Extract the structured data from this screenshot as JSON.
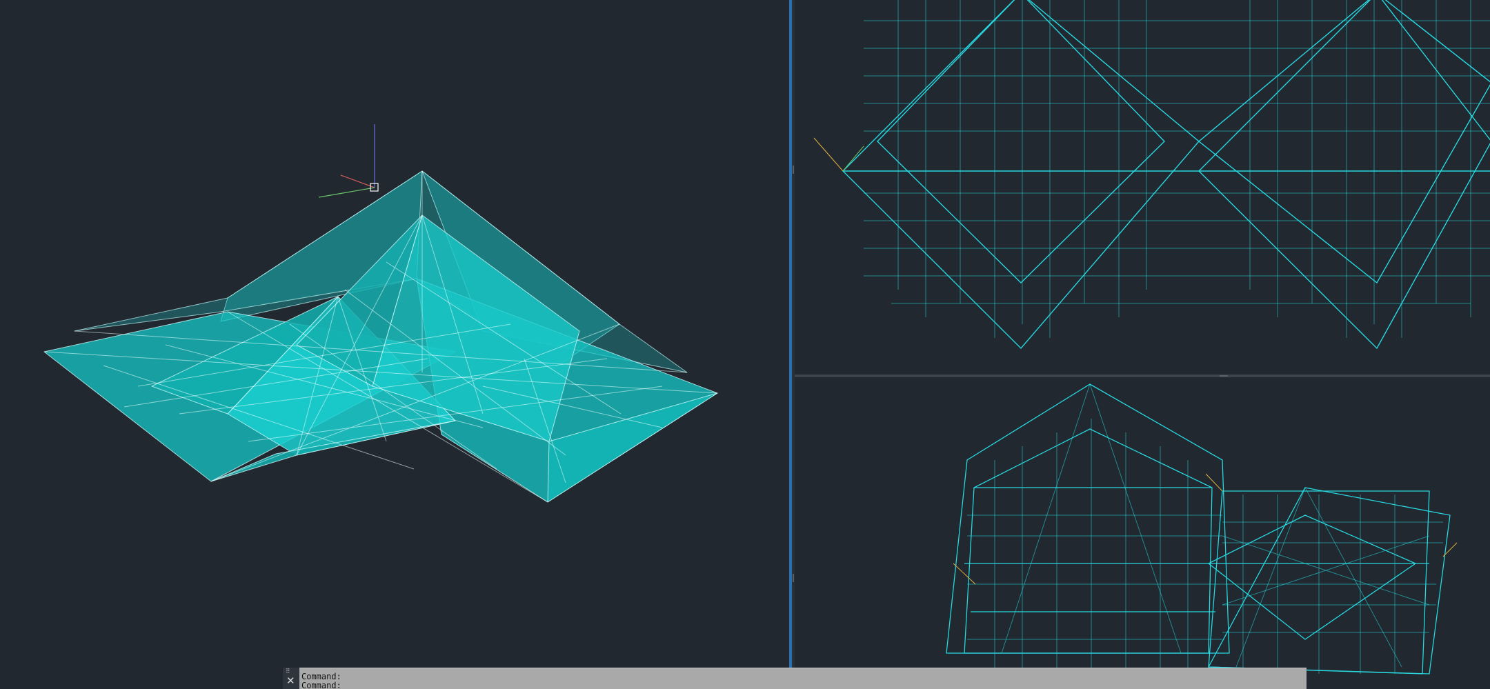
{
  "app": {
    "title": ""
  },
  "viewports": {
    "left": {
      "style": "3D shaded wireframe",
      "color": "#1ecfcf"
    },
    "top_right": {
      "style": "wireframe top view",
      "color": "#28d8e0"
    },
    "bottom_right": {
      "style": "wireframe front view",
      "color": "#28d8e0"
    }
  },
  "colors": {
    "background": "#212830",
    "active_viewport_border": "#2b6fb3",
    "wireframe": "#28d8e0",
    "command_bar": "#a9a9a9",
    "ucs_x": "#d25a5a",
    "ucs_y": "#6cc66c",
    "ucs_z": "#6a6ad8"
  },
  "ucs_icon": {
    "name": "ucs-icon"
  },
  "command_line": {
    "close_icon": "✕",
    "grip_icon": "⠿",
    "history": [
      "Command:",
      "Command:"
    ]
  }
}
